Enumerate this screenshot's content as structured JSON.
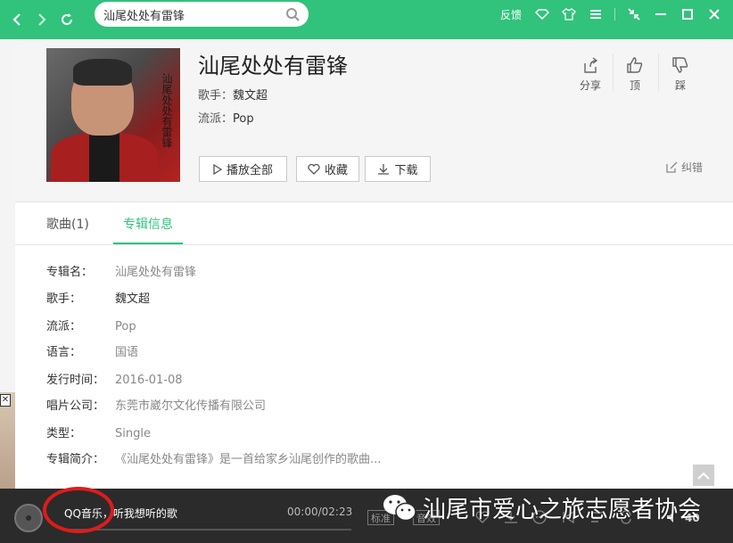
{
  "topbar": {
    "search_value": "汕尾处处有雷锋",
    "feedback_label": "反馈",
    "bg_color": "#31c27c"
  },
  "album": {
    "title": "汕尾处处有雷锋",
    "singer_label": "歌手：",
    "singer": "魏文超",
    "genre_label": "流派：",
    "genre": "Pop",
    "cover_text": "汕尾处处有雷锋"
  },
  "buttons": {
    "play_all": "播放全部",
    "favorite": "收藏",
    "download": "下载"
  },
  "actions": {
    "share": "分享",
    "like": "顶",
    "dislike": "踩",
    "report": "纠错"
  },
  "tabs": [
    {
      "label": "歌曲(1)"
    },
    {
      "label": "专辑信息"
    }
  ],
  "info": {
    "album_name_label": "专辑名：",
    "album_name": "汕尾处处有雷锋",
    "singer_label": "歌手：",
    "singer": "魏文超",
    "genre_label": "流派：",
    "genre": "Pop",
    "language_label": "语言：",
    "language": "国语",
    "release_label": "发行时间：",
    "release": "2016-01-08",
    "company_label": "唱片公司：",
    "company": "东莞市崴尔文化传播有限公司",
    "type_label": "类型：",
    "type": "Single",
    "intro_label": "专辑简介：",
    "intro": "《汕尾处处有雷锋》是一首给家乡汕尾创作的歌曲..."
  },
  "player": {
    "now_playing": "QQ音乐，听我想听的歌",
    "time": "00:00/02:23",
    "quality_standard": "标准",
    "quality_effect": "音效",
    "volume": "40"
  },
  "watermark": {
    "text": "汕尾市爱心之旅志愿者协会"
  },
  "colors": {
    "accent": "#31c27c",
    "annotation": "#e01b1b"
  }
}
